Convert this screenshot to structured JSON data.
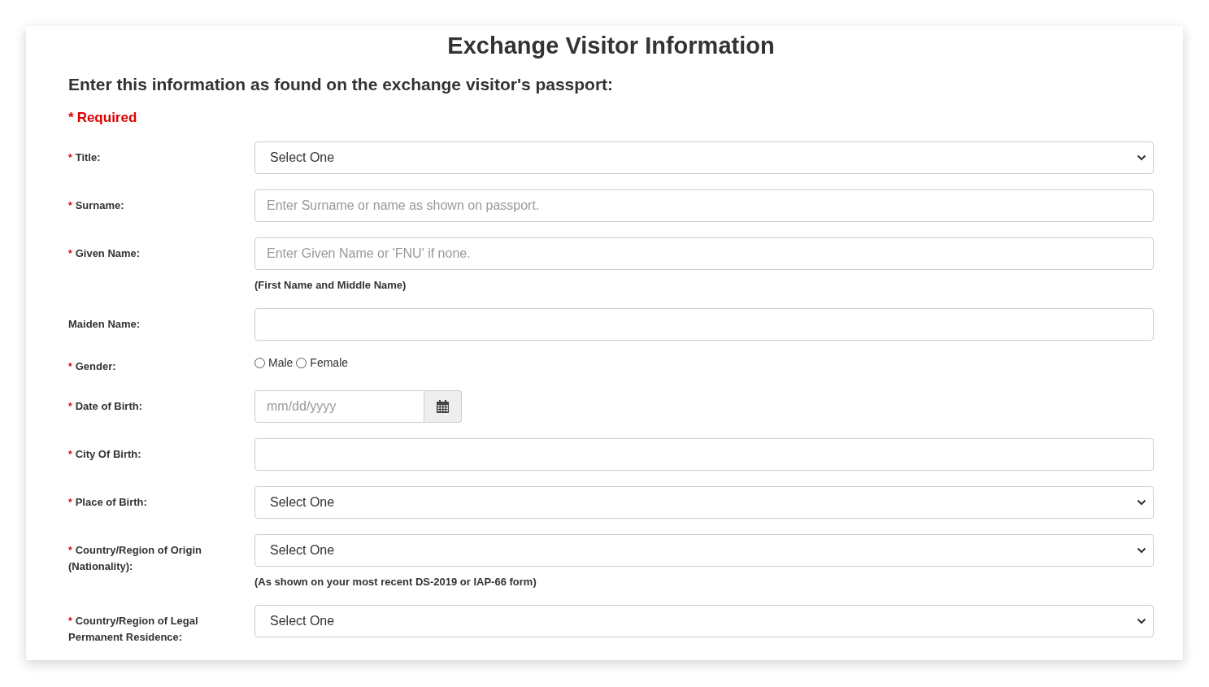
{
  "title": "Exchange Visitor Information",
  "subtitle": "Enter this information as found on the exchange visitor's passport:",
  "required_mark": "*",
  "required_legend": "Required",
  "fields": [
    {
      "kind": "select",
      "label": "Title:",
      "required": true,
      "value": "Select One"
    },
    {
      "kind": "text",
      "label": "Surname:",
      "required": true,
      "placeholder": "Enter Surname or name as shown on passport."
    },
    {
      "kind": "text",
      "label": "Given Name:",
      "required": true,
      "placeholder": "Enter Given Name or 'FNU' if none.",
      "hint": "(First Name and Middle Name)"
    },
    {
      "kind": "text",
      "label": "Maiden Name:",
      "required": false
    },
    {
      "kind": "radio",
      "label": "Gender:",
      "required": true,
      "options": [
        {
          "label": "Male",
          "selected": false
        },
        {
          "label": "Female",
          "selected": false
        }
      ]
    },
    {
      "kind": "date",
      "label": "Date of Birth:",
      "required": true,
      "placeholder": "mm/dd/yyyy"
    },
    {
      "kind": "text",
      "label": "City Of Birth:",
      "required": true
    },
    {
      "kind": "select",
      "label": "Place of Birth:",
      "required": true,
      "value": "Select One"
    },
    {
      "kind": "select",
      "label": "Country/Region of Origin (Nationality):",
      "required": true,
      "value": "Select One",
      "hint": "(As shown on your most recent DS-2019 or IAP-66 form)"
    },
    {
      "kind": "select",
      "label": "Country/Region of Legal Permanent Residence:",
      "required": true,
      "value": "Select One"
    }
  ]
}
